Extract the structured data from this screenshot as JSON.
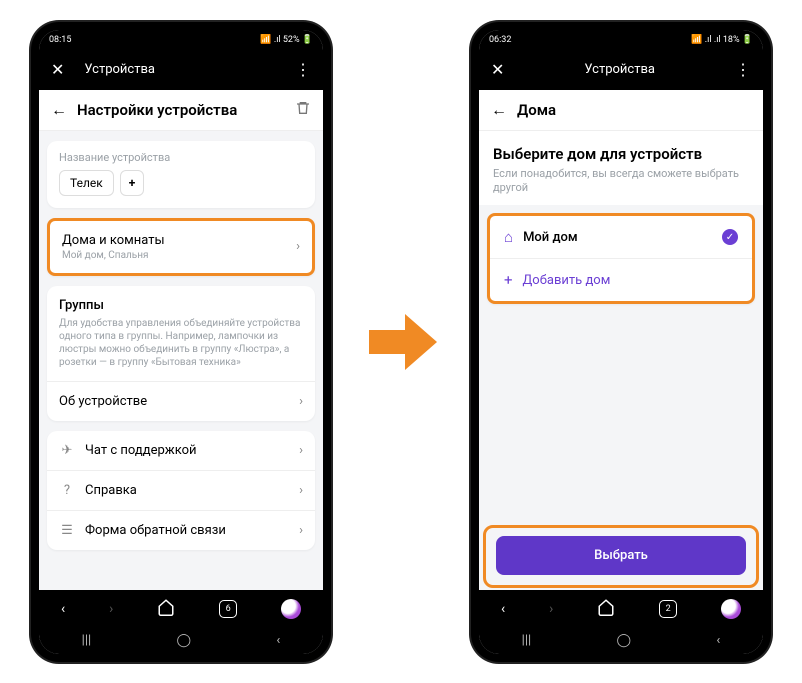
{
  "left": {
    "status": {
      "time": "08:15",
      "icons": "⛶ ⌂",
      "right": "📶 .ıl 52% 🔋"
    },
    "appbar": {
      "title": "Устройства"
    },
    "header": "Настройки устройства",
    "device_name_label": "Название устройства",
    "device_name": "Телек",
    "rows": {
      "homes": {
        "title": "Дома и комнаты",
        "sub": "Мой дом, Спальня"
      },
      "groups": {
        "title": "Группы",
        "desc": "Для удобства управления объединяйте устройства одного типа в группы. Например, лампочки из люстры можно объединить в группу «Люстра», а розетки — в группу «Бытовая техника»"
      },
      "about": "Об устройстве",
      "chat": "Чат с поддержкой",
      "help": "Справка",
      "feedback": "Форма обратной связи"
    },
    "tabs": "6"
  },
  "right": {
    "status": {
      "time": "06:32",
      "icons": "⊙ ⛶ ⌂",
      "right": "📶 .ıl .ıl 18% 🔋"
    },
    "appbar": {
      "title": "Устройства"
    },
    "header": "Дома",
    "title": "Выберите дом для устройств",
    "sub": "Если понадобится, вы всегда сможете выбрать другой",
    "home_name": "Мой дом",
    "add_home": "Добавить дом",
    "button": "Выбрать",
    "tabs": "2"
  }
}
